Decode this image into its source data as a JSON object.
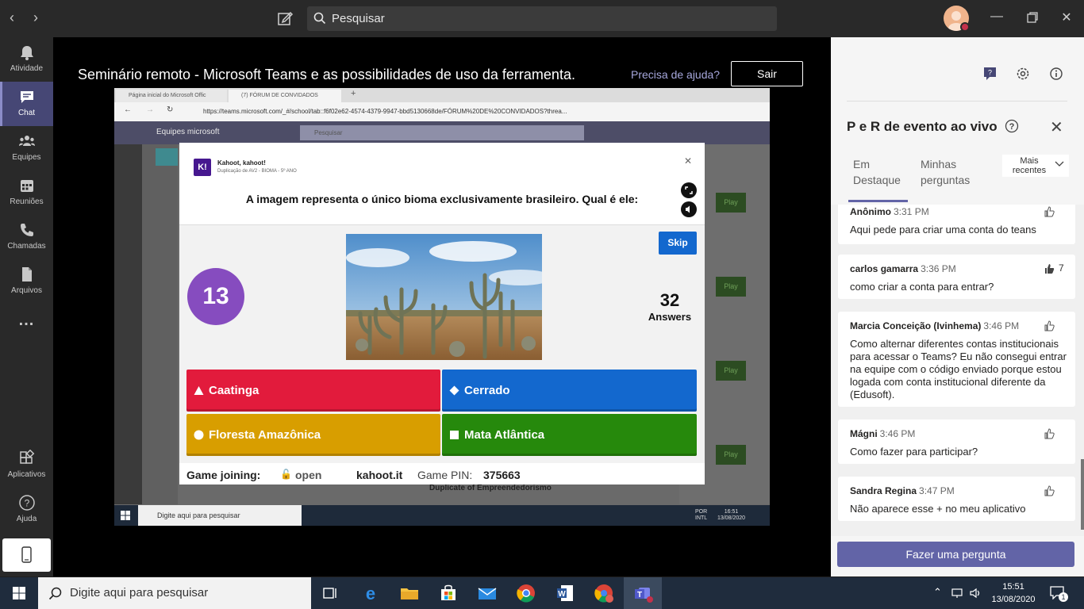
{
  "titlebar": {
    "search_placeholder": "Pesquisar"
  },
  "rail": {
    "items": [
      {
        "label": "Atividade",
        "icon": "bell-icon"
      },
      {
        "label": "Chat",
        "icon": "chat-icon"
      },
      {
        "label": "Equipes",
        "icon": "teams-icon"
      },
      {
        "label": "Reuniões",
        "icon": "calendar-icon"
      },
      {
        "label": "Chamadas",
        "icon": "phone-icon"
      },
      {
        "label": "Arquivos",
        "icon": "file-icon"
      },
      {
        "label": "...",
        "icon": "more-icon"
      },
      {
        "label": "Aplicativos",
        "icon": "apps-icon"
      },
      {
        "label": "Ajuda",
        "icon": "help-icon"
      }
    ]
  },
  "stage": {
    "title": "Seminário remoto - Microsoft Teams e as possibilidades de uso da ferramenta.",
    "help_link": "Precisa de ajuda?",
    "leave_label": "Sair"
  },
  "shared_screen": {
    "tabs": [
      "Página inicial do Microsoft Offic",
      "(7) FÓRUM DE CONVIDADOS"
    ],
    "url": "https://teams.microsoft.com/_#/school/tab::f6f02e62-4574-4379-9947-bbd5130668de/FÓRUM%20DE%20CONVIDADOS?threa...",
    "teams_title": "Equipes microsoft",
    "teams_search": "Pesquisar",
    "play_label": "Play",
    "background_item": "Duplicate of Empreendedorismo",
    "kahoot": {
      "brand": "Kahoot, kahoot!",
      "subtitle": "Duplicação de AV2 - BIOMA - 5º ANO",
      "question": "A imagem representa o único bioma exclusivamente brasileiro. Qual é ele:",
      "skip_label": "Skip",
      "timer": "13",
      "answers_count": "32",
      "answers_label": "Answers",
      "options": [
        {
          "label": "Caatinga",
          "color": "#e21b3c",
          "shape": "triangle"
        },
        {
          "label": "Cerrado",
          "color": "#1368ce",
          "shape": "diamond"
        },
        {
          "label": "Floresta Amazônica",
          "color": "#d89e00",
          "shape": "circle"
        },
        {
          "label": "Mata Atlântica",
          "color": "#26890c",
          "shape": "square"
        }
      ],
      "footer": {
        "joining_label": "Game joining:",
        "joining_status": "open",
        "site": "kahoot.it",
        "pin_label": "Game PIN:",
        "pin": "375663"
      }
    },
    "taskbar": {
      "search": "Digite aqui para pesquisar",
      "lang": "POR",
      "lang2": "INTL",
      "time": "16:51",
      "date": "13/08/2020"
    }
  },
  "panel": {
    "title": "P e R de evento ao vivo",
    "tabs": [
      "Em Destaque",
      "Minhas perguntas"
    ],
    "sort_label": "Mais recentes",
    "ask_button": "Fazer uma pergunta",
    "questions": [
      {
        "author": "Anônimo",
        "time": "3:31 PM",
        "text": "Aqui pede para criar uma conta do teans",
        "likes": ""
      },
      {
        "author": "carlos gamarra",
        "time": "3:36 PM",
        "text": "como criar a conta para entrar?",
        "likes": "7"
      },
      {
        "author": "Marcia Conceição (Ivinhema)",
        "time": "3:46 PM",
        "text": "Como alternar diferentes contas institucionais para acessar o Teams? Eu não consegui entrar na equipe com o código enviado porque estou logada com conta institucional diferente da (Edusoft).",
        "likes": ""
      },
      {
        "author": "Mágni",
        "time": "3:46 PM",
        "text": "Como fazer para participar?",
        "likes": ""
      },
      {
        "author": "Sandra Regina",
        "time": "3:47 PM",
        "text": "Não aparece esse + no meu aplicativo",
        "likes": ""
      }
    ]
  },
  "taskbar": {
    "search_placeholder": "Digite aqui para pesquisar",
    "time": "15:51",
    "date": "13/08/2020",
    "notifications": "1"
  },
  "colors": {
    "teams_purple": "#6264a7",
    "rail_active": "#464775",
    "kahoot_purple": "#864cbf"
  }
}
